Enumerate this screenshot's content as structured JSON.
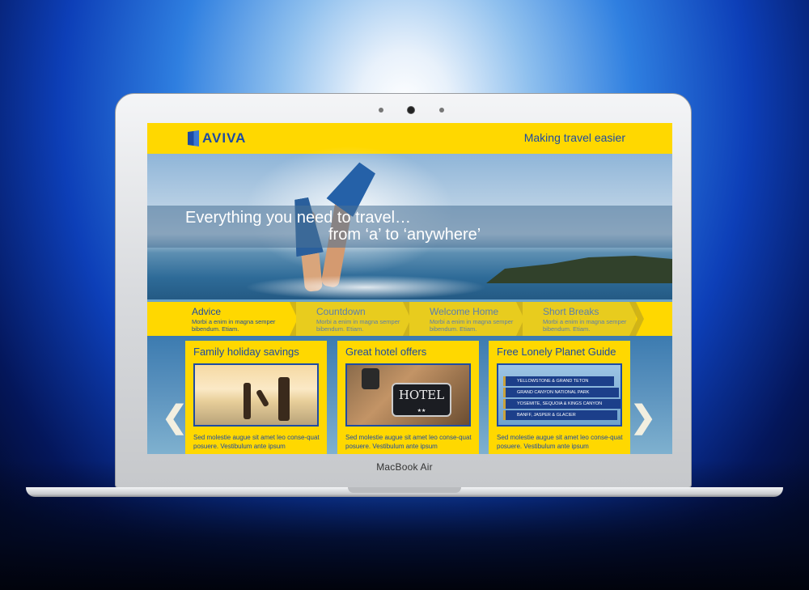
{
  "device": {
    "label": "MacBook Air"
  },
  "header": {
    "logo_text": "AVIVA",
    "tagline": "Making travel easier"
  },
  "hero": {
    "headline_line1": "Everything you need to travel…",
    "headline_line2": "from ‘a’ to ‘anywhere’"
  },
  "tabs": [
    {
      "title": "Advice",
      "body": "Morbi a enim in magna semper bibendum. Etiam.",
      "active": true
    },
    {
      "title": "Countdown",
      "body": "Morbi a enim in magna semper bibendum. Etiam.",
      "active": false
    },
    {
      "title": "Welcome Home",
      "body": "Morbi a enim in magna semper bibendum. Etiam.",
      "active": false
    },
    {
      "title": "Short Breaks",
      "body": "Morbi a enim in magna semper bibendum. Etiam.",
      "active": false
    }
  ],
  "cards": [
    {
      "title": "Family holiday savings",
      "text": "Sed molestie augue sit amet leo conse-quat posuere. Vestibulum ante ipsum"
    },
    {
      "title": "Great hotel offers",
      "text": "Sed molestie augue sit amet leo conse-quat posuere. Vestibulum ante ipsum",
      "sign_text": "HOTEL",
      "sign_stars": "★★"
    },
    {
      "title": "Free Lonely Planet Guide",
      "text": "Sed molestie augue sit amet leo conse-quat posuere. Vestibulum ante ipsum",
      "book_spines": [
        "YELLOWSTONE & GRAND TETON",
        "GRAND CANYON NATIONAL PARK",
        "YOSEMITE, SEQUOIA & KINGS CANYON",
        "BANFF, JASPER & GLACIER"
      ]
    }
  ],
  "carousel": {
    "prev_glyph": "❮",
    "next_glyph": "❯"
  },
  "colors": {
    "brand_yellow": "#ffd800",
    "brand_blue": "#1d4ba3"
  }
}
